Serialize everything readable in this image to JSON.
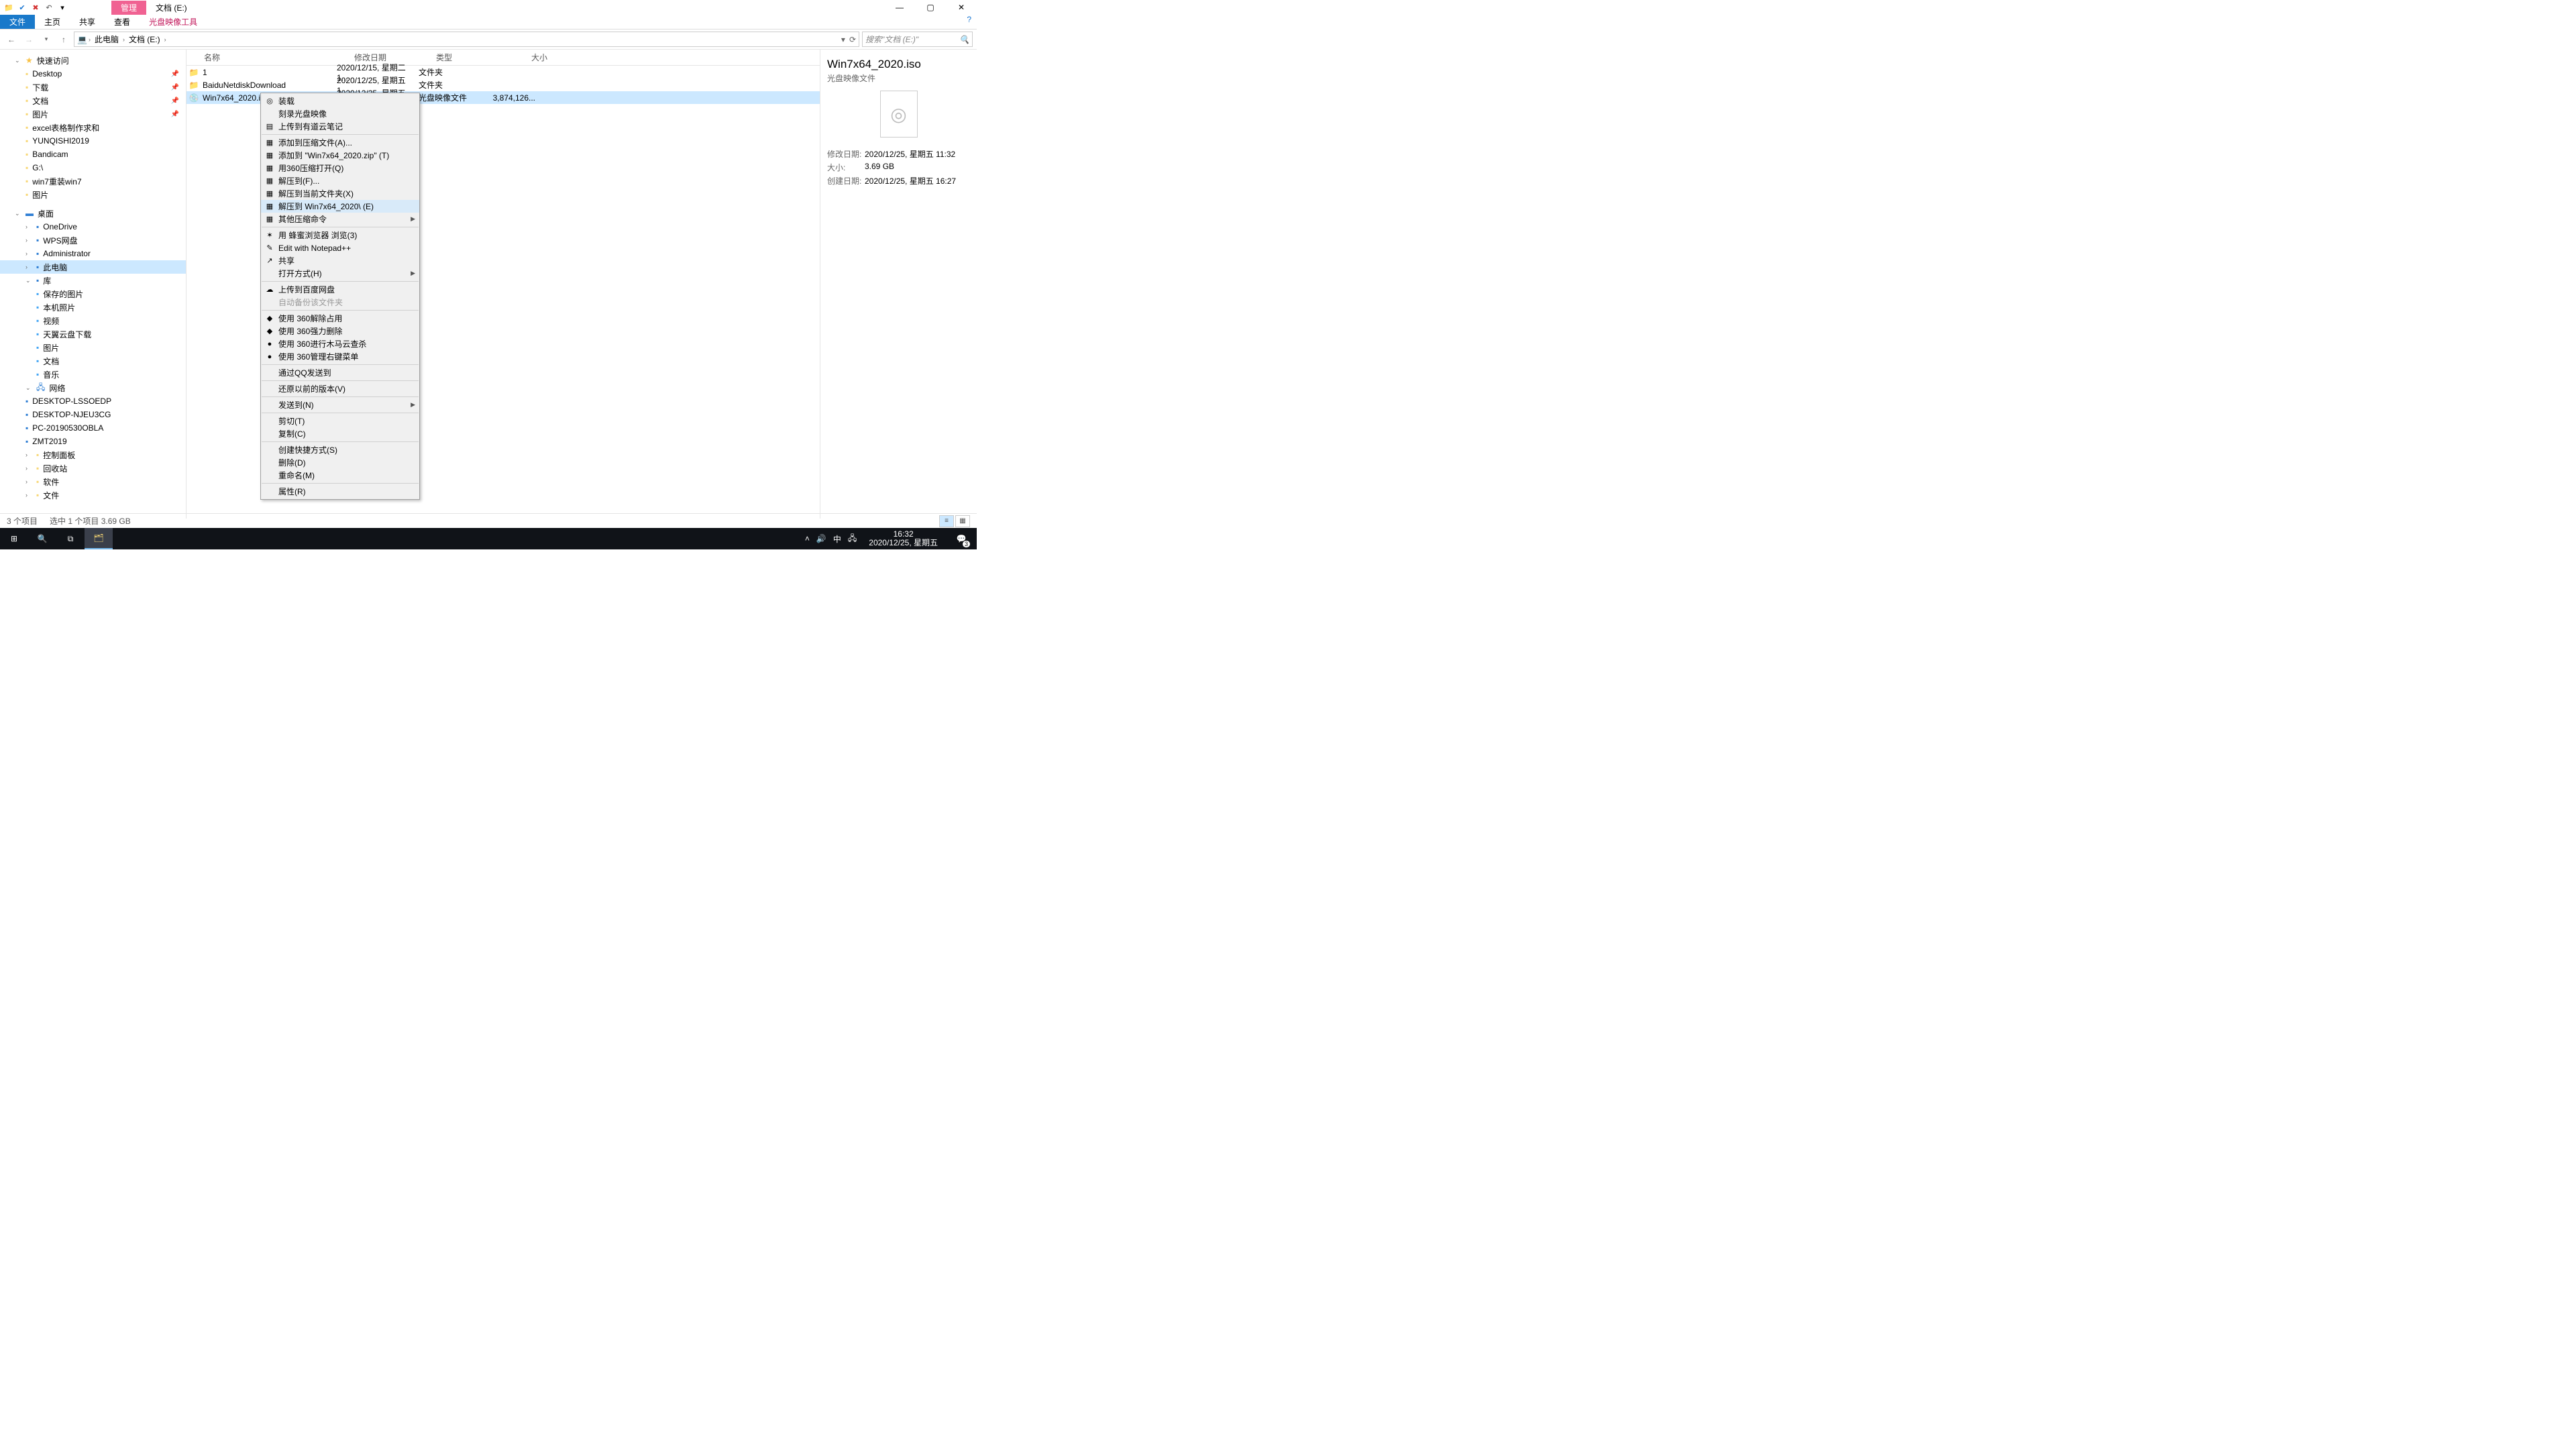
{
  "title_tab_manage": "管理",
  "title_tab_loc": "文档 (E:)",
  "ribbon": {
    "file": "文件",
    "home": "主页",
    "share": "共享",
    "view": "查看",
    "tool": "光盘映像工具"
  },
  "crumbs": [
    "此电脑",
    "文档 (E:)"
  ],
  "search_placeholder": "搜索\"文档 (E:)\"",
  "cols": {
    "name": "名称",
    "date": "修改日期",
    "type": "类型",
    "size": "大小"
  },
  "rows": [
    {
      "name": "1",
      "date": "2020/12/15, 星期二 1...",
      "type": "文件夹",
      "size": ""
    },
    {
      "name": "BaiduNetdiskDownload",
      "date": "2020/12/25, 星期五 1...",
      "type": "文件夹",
      "size": ""
    },
    {
      "name": "Win7x64_2020.iso",
      "date": "2020/12/25, 星期五 1...",
      "type": "光盘映像文件",
      "size": "3,874,126..."
    }
  ],
  "nav": {
    "quick": "快速访问",
    "quick_items": [
      "Desktop",
      "下载",
      "文档",
      "图片",
      "excel表格制作求和",
      "YUNQISHI2019",
      "Bandicam",
      "G:\\",
      "win7重装win7",
      "图片"
    ],
    "desktop": "桌面",
    "desktop_items": [
      "OneDrive",
      "WPS网盘",
      "Administrator",
      "此电脑",
      "库"
    ],
    "lib_items": [
      "保存的图片",
      "本机照片",
      "视频",
      "天翼云盘下载",
      "图片",
      "文档",
      "音乐"
    ],
    "network": "网络",
    "net_items": [
      "DESKTOP-LSSOEDP",
      "DESKTOP-NJEU3CG",
      "PC-20190530OBLA",
      "ZMT2019"
    ],
    "tail": [
      "控制面板",
      "回收站",
      "软件",
      "文件"
    ]
  },
  "ctx": [
    {
      "t": "装载",
      "i": "◎"
    },
    {
      "t": "刻录光盘映像"
    },
    {
      "t": "上传到有道云笔记",
      "i": "▤"
    },
    {
      "sep": true
    },
    {
      "t": "添加到压缩文件(A)...",
      "i": "▦"
    },
    {
      "t": "添加到 \"Win7x64_2020.zip\" (T)",
      "i": "▦"
    },
    {
      "t": "用360压缩打开(Q)",
      "i": "▦"
    },
    {
      "t": "解压到(F)...",
      "i": "▦"
    },
    {
      "t": "解压到当前文件夹(X)",
      "i": "▦"
    },
    {
      "t": "解压到 Win7x64_2020\\ (E)",
      "i": "▦",
      "hot": true
    },
    {
      "t": "其他压缩命令",
      "i": "▦",
      "sub": true
    },
    {
      "sep": true
    },
    {
      "t": "用 蜂蜜浏览器 浏览(3)",
      "i": "✶"
    },
    {
      "t": "Edit with Notepad++",
      "i": "✎"
    },
    {
      "t": "共享",
      "i": "↗"
    },
    {
      "t": "打开方式(H)",
      "sub": true
    },
    {
      "sep": true
    },
    {
      "t": "上传到百度网盘",
      "i": "☁"
    },
    {
      "t": "自动备份该文件夹",
      "dis": true
    },
    {
      "sep": true
    },
    {
      "t": "使用 360解除占用",
      "i": "◆"
    },
    {
      "t": "使用 360强力删除",
      "i": "◆"
    },
    {
      "t": "使用 360进行木马云查杀",
      "i": "●"
    },
    {
      "t": "使用 360管理右键菜单",
      "i": "●"
    },
    {
      "sep": true
    },
    {
      "t": "通过QQ发送到"
    },
    {
      "sep": true
    },
    {
      "t": "还原以前的版本(V)"
    },
    {
      "sep": true
    },
    {
      "t": "发送到(N)",
      "sub": true
    },
    {
      "sep": true
    },
    {
      "t": "剪切(T)"
    },
    {
      "t": "复制(C)"
    },
    {
      "sep": true
    },
    {
      "t": "创建快捷方式(S)"
    },
    {
      "t": "删除(D)"
    },
    {
      "t": "重命名(M)"
    },
    {
      "sep": true
    },
    {
      "t": "属性(R)"
    }
  ],
  "details": {
    "title": "Win7x64_2020.iso",
    "sub": "光盘映像文件",
    "k_mod": "修改日期:",
    "v_mod": "2020/12/25, 星期五 11:32",
    "k_size": "大小:",
    "v_size": "3.69 GB",
    "k_cre": "创建日期:",
    "v_cre": "2020/12/25, 星期五 16:27"
  },
  "status": {
    "count": "3 个项目",
    "sel": "选中 1 个项目  3.69 GB"
  },
  "taskbar": {
    "time": "16:32",
    "date": "2020/12/25, 星期五",
    "badge": "3",
    "ime": "中"
  }
}
